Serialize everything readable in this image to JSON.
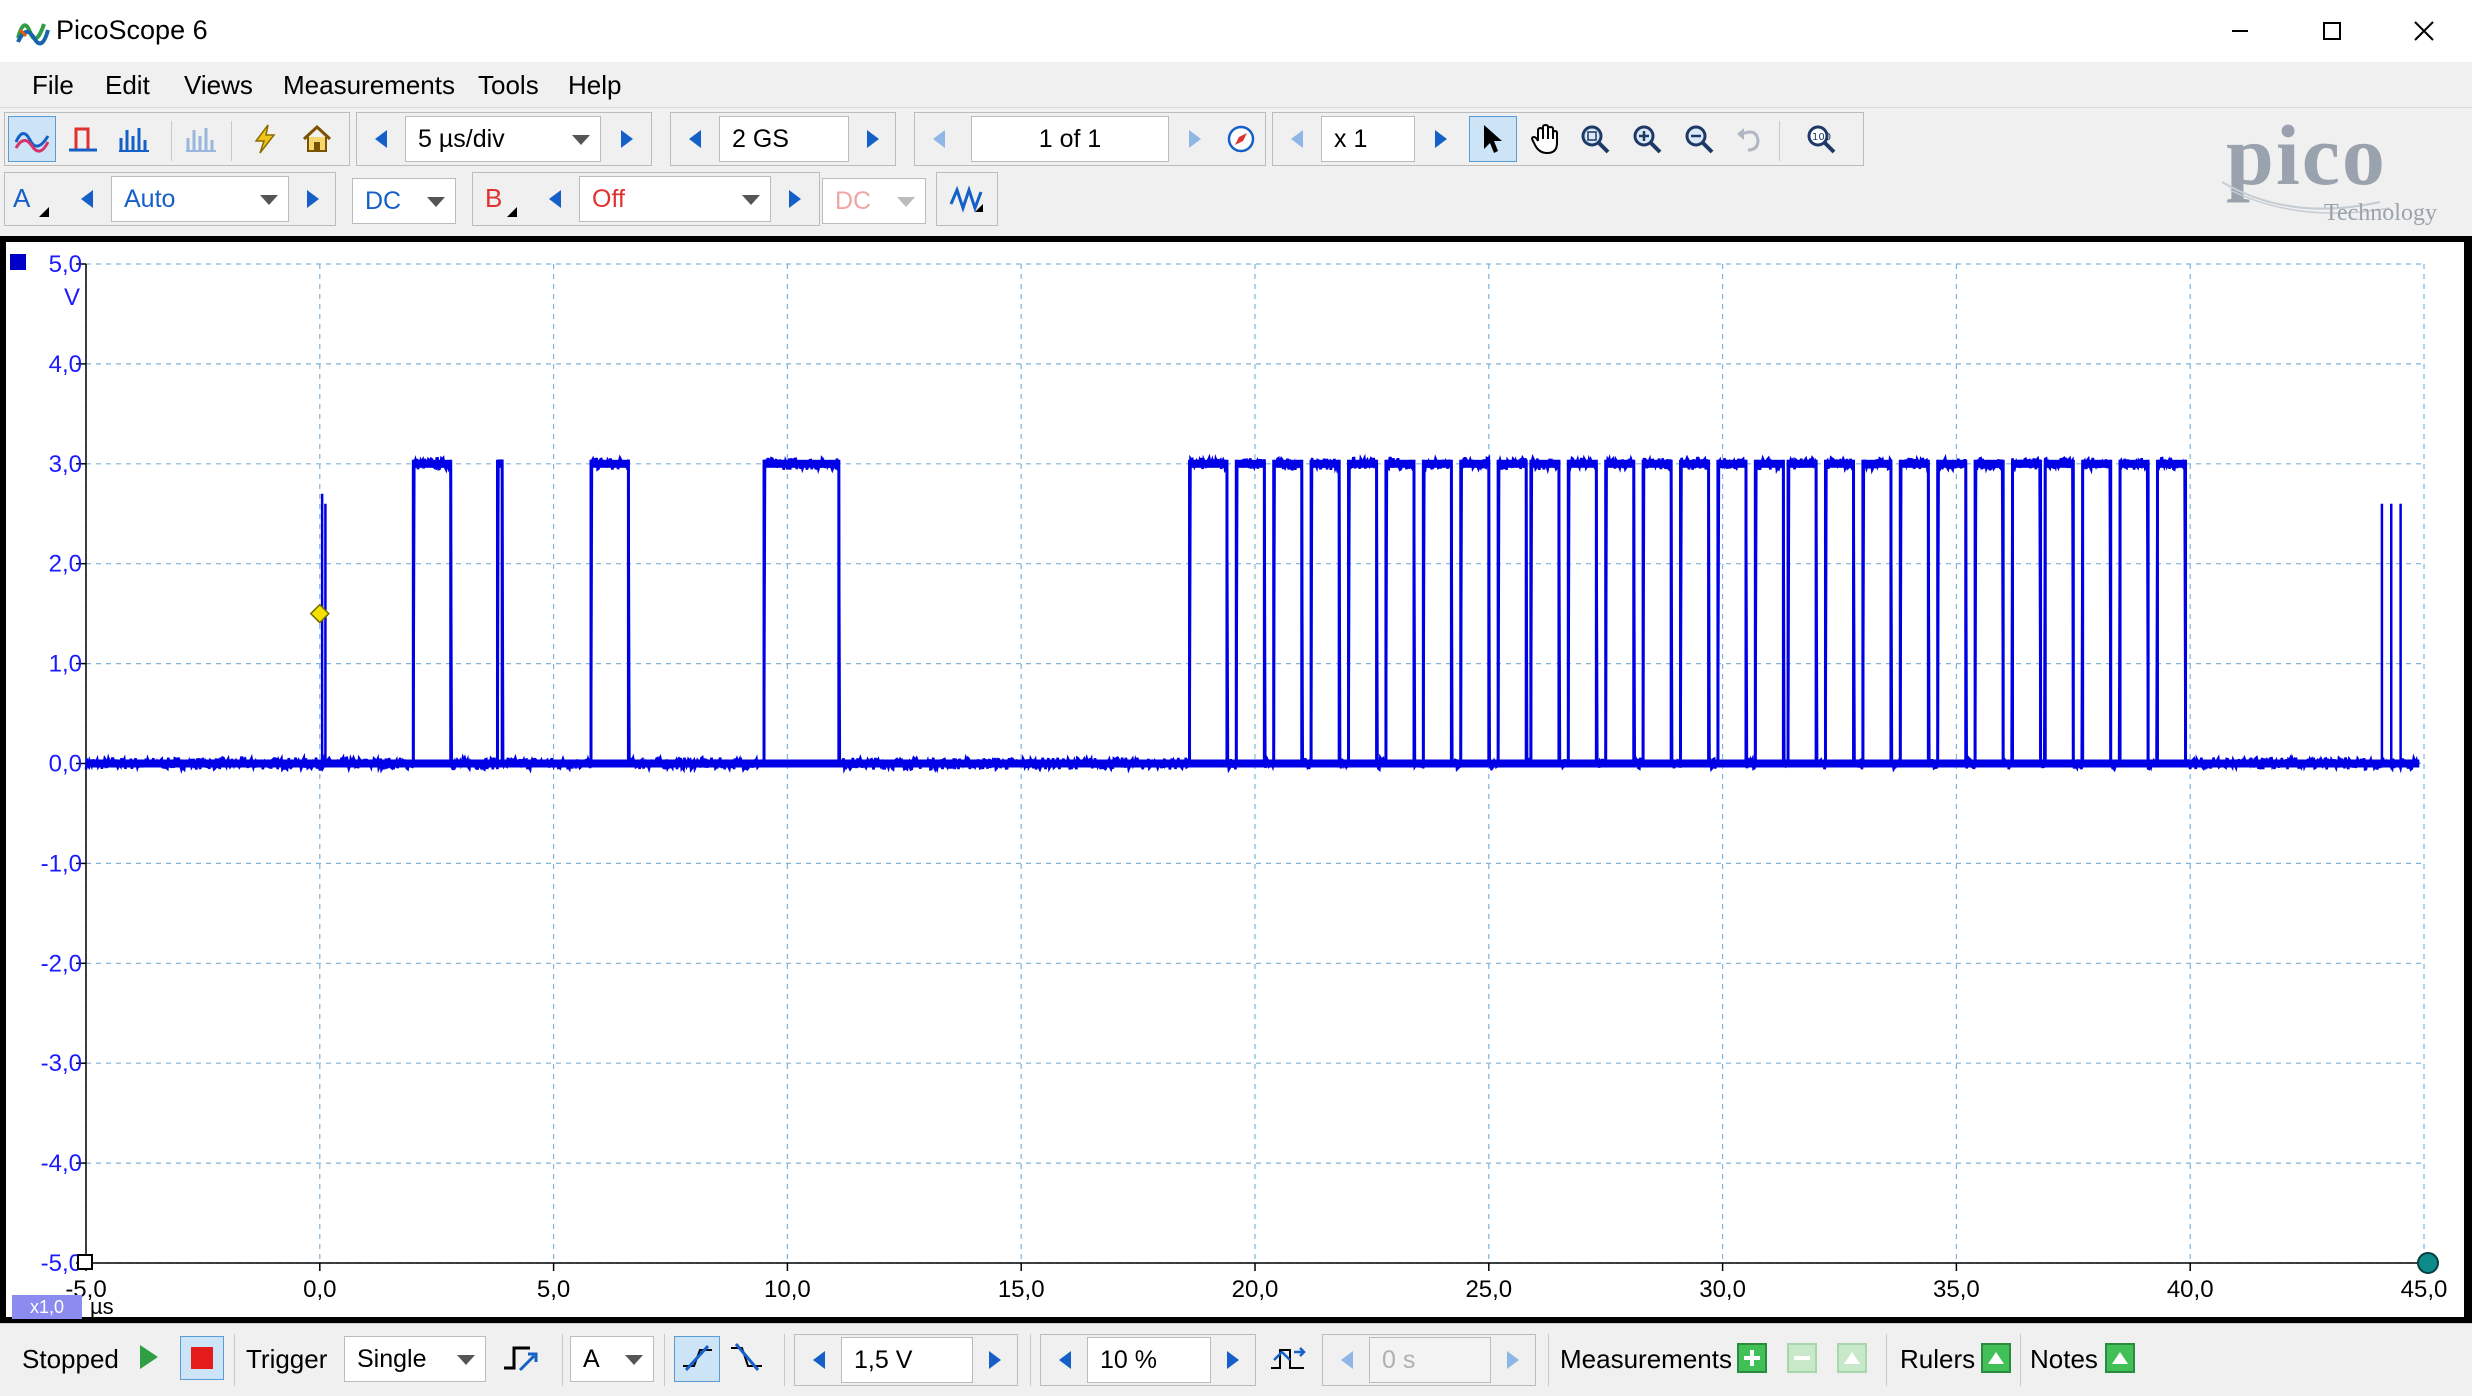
{
  "window": {
    "title": "PicoScope 6",
    "controls": [
      "minimize",
      "maximize",
      "close"
    ]
  },
  "menu": [
    "File",
    "Edit",
    "Views",
    "Measurements",
    "Tools",
    "Help"
  ],
  "toolbar1": {
    "timebase": "5 µs/div",
    "samples": "2 GS",
    "buffer": "1 of 1",
    "zoom": "x 1"
  },
  "toolbar2": {
    "channel_a": {
      "label": "A",
      "range": "Auto",
      "coupling": "DC"
    },
    "channel_b": {
      "label": "B",
      "range": "Off",
      "coupling": "DC"
    }
  },
  "brand": {
    "logo": "pico",
    "sub": "Technology"
  },
  "scope": {
    "y_unit": "V",
    "y_ticks": [
      "5,0",
      "4,0",
      "3,0",
      "2,0",
      "1,0",
      "0,0",
      "-1,0",
      "-2,0",
      "-3,0",
      "-4,0",
      "-5,0"
    ],
    "x_ticks": [
      "-5,0",
      "0,0",
      "5,0",
      "10,0",
      "15,0",
      "20,0",
      "25,0",
      "30,0",
      "35,0",
      "40,0",
      "45,0"
    ],
    "x_unit": "µs",
    "x_scale_badge": "x1,0",
    "trace_color": "#0000e6",
    "trigger_marker_color": "#f5e000"
  },
  "chart_data": {
    "type": "line",
    "title": "",
    "xlabel": "µs",
    "ylabel": "V",
    "xlim": [
      -5,
      45
    ],
    "ylim": [
      -5,
      5
    ],
    "grid": true,
    "series": [
      {
        "name": "",
        "color": "#0000e6",
        "high": 3.0,
        "low": 0.0,
        "pulses": [
          [
            2.0,
            2.8
          ],
          [
            3.8,
            3.9
          ],
          [
            5.8,
            6.6
          ],
          [
            9.5,
            11.1
          ],
          [
            18.6,
            19.4
          ],
          [
            19.6,
            20.2
          ],
          [
            20.4,
            21.0
          ],
          [
            21.2,
            21.8
          ],
          [
            22.0,
            22.6
          ],
          [
            22.8,
            23.4
          ],
          [
            23.6,
            24.2
          ],
          [
            24.4,
            25.0
          ],
          [
            25.2,
            25.8
          ],
          [
            25.9,
            26.5
          ],
          [
            26.7,
            27.3
          ],
          [
            27.5,
            28.1
          ],
          [
            28.3,
            28.9
          ],
          [
            29.1,
            29.7
          ],
          [
            29.9,
            30.5
          ],
          [
            30.7,
            31.3
          ],
          [
            31.4,
            32.0
          ],
          [
            32.2,
            32.8
          ],
          [
            33.0,
            33.6
          ],
          [
            33.8,
            34.4
          ],
          [
            34.6,
            35.2
          ],
          [
            35.4,
            36.0
          ],
          [
            36.2,
            36.8
          ],
          [
            36.9,
            37.5
          ],
          [
            37.7,
            38.3
          ],
          [
            38.5,
            39.1
          ],
          [
            39.3,
            39.9
          ]
        ],
        "glitches": [
          {
            "x": 0.05,
            "peak": 2.7
          },
          {
            "x": 0.12,
            "peak": 2.6
          },
          {
            "x": 44.1,
            "peak": 2.6
          },
          {
            "x": 44.3,
            "peak": 2.6
          },
          {
            "x": 44.5,
            "peak": 2.6
          }
        ]
      }
    ],
    "trigger": {
      "x": 0.0,
      "y": 1.5
    }
  },
  "status": {
    "state": "Stopped",
    "trigger_label": "Trigger",
    "trigger_mode": "Single",
    "trigger_channel": "A",
    "threshold": "1,5 V",
    "pretrigger": "10 %",
    "delay": "0 s",
    "measurements": "Measurements",
    "rulers": "Rulers",
    "notes": "Notes"
  }
}
